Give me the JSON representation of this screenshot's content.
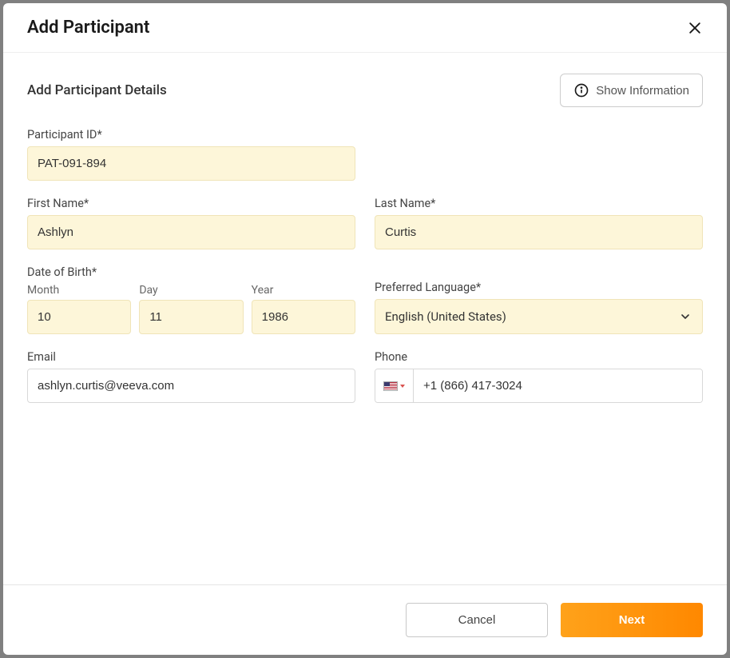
{
  "modal": {
    "title": "Add Participant"
  },
  "section": {
    "title": "Add Participant Details",
    "show_info": "Show Information"
  },
  "fields": {
    "participant_id": {
      "label": "Participant ID*",
      "value": "PAT-091-894"
    },
    "first_name": {
      "label": "First Name*",
      "value": "Ashlyn"
    },
    "last_name": {
      "label": "Last Name*",
      "value": "Curtis"
    },
    "dob": {
      "label": "Date of Birth*",
      "month_label": "Month",
      "month_value": "10",
      "day_label": "Day",
      "day_value": "11",
      "year_label": "Year",
      "year_value": "1986"
    },
    "language": {
      "label": "Preferred Language*",
      "value": "English (United States)"
    },
    "email": {
      "label": "Email",
      "value": "ashlyn.curtis@veeva.com"
    },
    "phone": {
      "label": "Phone",
      "value": "+1 (866) 417-3024"
    }
  },
  "footer": {
    "cancel": "Cancel",
    "next": "Next"
  }
}
